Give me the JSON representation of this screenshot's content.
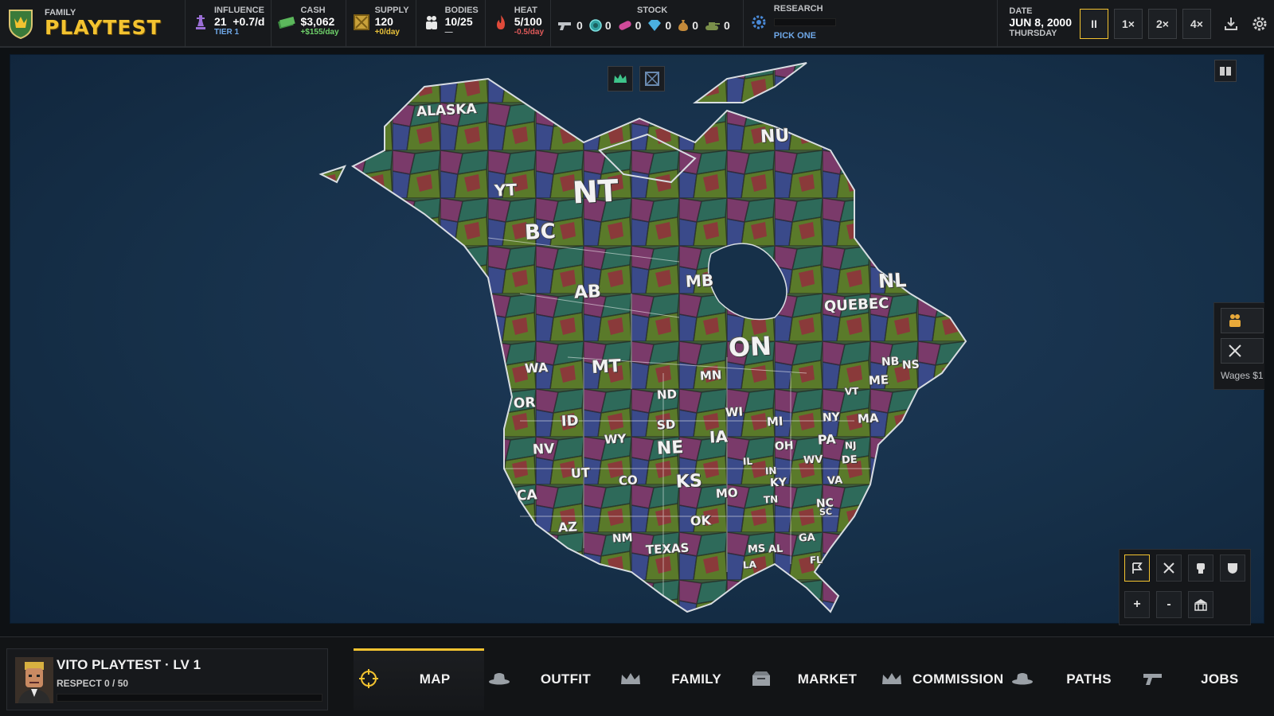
{
  "family": {
    "label": "FAMILY",
    "name": "PLAYTEST"
  },
  "stats": {
    "influence": {
      "label": "INFLUENCE",
      "value": "21",
      "rate": "+0.7/d",
      "sub": "TIER 1"
    },
    "cash": {
      "label": "CASH",
      "value": "$3,062",
      "sub": "+$155/day"
    },
    "supply": {
      "label": "SUPPLY",
      "value": "120",
      "sub": "+0/day"
    },
    "bodies": {
      "label": "BODIES",
      "value": "10/25",
      "sub": "—"
    },
    "heat": {
      "label": "HEAT",
      "value": "5/100",
      "sub": "-0.5/day"
    }
  },
  "stock": {
    "label": "STOCK",
    "items": [
      {
        "icon": "pistol-icon",
        "value": "0"
      },
      {
        "icon": "chip-icon",
        "value": "0"
      },
      {
        "icon": "pill-icon",
        "value": "0"
      },
      {
        "icon": "diamond-icon",
        "value": "0"
      },
      {
        "icon": "moneybag-icon",
        "value": "0"
      },
      {
        "icon": "tank-icon",
        "value": "0"
      }
    ]
  },
  "research": {
    "label": "RESEARCH",
    "pick": "PICK ONE"
  },
  "date": {
    "label": "DATE",
    "value": "JUN 8, 2000",
    "weekday": "THURSDAY"
  },
  "speed": {
    "pause": "II",
    "s1": "1×",
    "s2": "2×",
    "s4": "4×"
  },
  "map_labels": [
    "ALASKA",
    "YT",
    "NT",
    "NU",
    "BC",
    "AB",
    "MB",
    "NL",
    "QUEBEC",
    "ON",
    "NB",
    "NS",
    "WA",
    "MT",
    "MN",
    "ND",
    "ME",
    "OR",
    "ID",
    "WY",
    "SD",
    "WI",
    "MI",
    "VT",
    "NY",
    "MA",
    "NV",
    "NE",
    "IA",
    "OH",
    "PA",
    "NJ",
    "WV",
    "DE",
    "UT",
    "CO",
    "KS",
    "IL",
    "IN",
    "KY",
    "VA",
    "CA",
    "MO",
    "TN",
    "NC",
    "AZ",
    "NM",
    "OK",
    "TEXAS",
    "SC",
    "GA",
    "MS",
    "AL",
    "LA",
    "FL"
  ],
  "side": {
    "wages": "Wages $1"
  },
  "zoom": {
    "plus": "+",
    "minus": "-"
  },
  "player": {
    "name": "VITO PLAYTEST · LV 1",
    "respect": "RESPECT 0 / 50"
  },
  "nav": [
    {
      "label": "MAP",
      "icon": "crosshair-icon"
    },
    {
      "label": "OUTFIT",
      "icon": "fedora-icon"
    },
    {
      "label": "FAMILY",
      "icon": "crown-icon"
    },
    {
      "label": "MARKET",
      "icon": "crate-icon"
    },
    {
      "label": "COMMISSION",
      "icon": "crown-icon"
    },
    {
      "label": "PATHS",
      "icon": "fedora-icon"
    },
    {
      "label": "JOBS",
      "icon": "revolver-icon"
    }
  ],
  "colors": {
    "accent": "#f3c330",
    "positive": "#6fd26a",
    "negative": "#e05a5a",
    "link": "#6fa8e8",
    "ocean": "#163049"
  }
}
